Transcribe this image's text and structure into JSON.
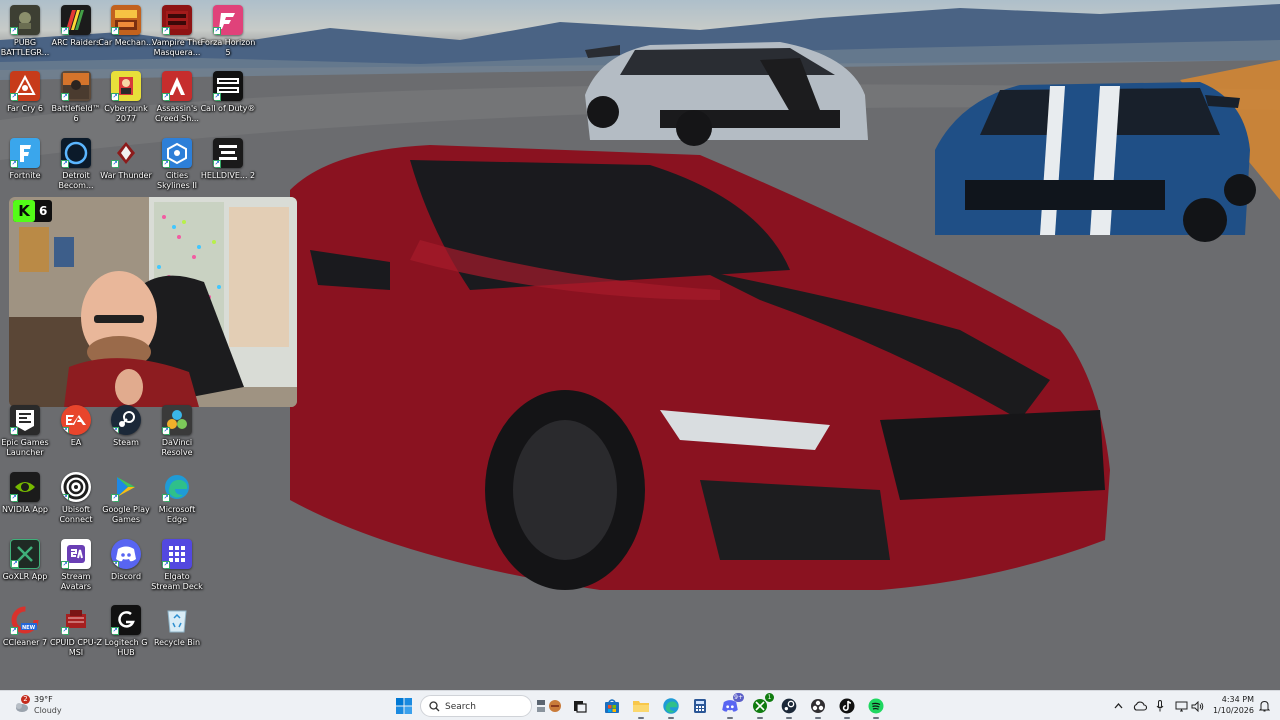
{
  "desktop": {
    "icons": [
      {
        "label": "PUBG BATTLEGR...",
        "icon": "pubg-icon",
        "color": "#3d3f33"
      },
      {
        "label": "ARC Raiders",
        "icon": "arc-raiders-icon",
        "color": "#1b1b1b"
      },
      {
        "label": "Car Mechan...",
        "icon": "car-mechanic-icon",
        "color": "#c2621e"
      },
      {
        "label": "Vampire The Masquera...",
        "icon": "vampire-icon",
        "color": "#8e1414"
      },
      {
        "label": "Forza Horizon 5",
        "icon": "forza-icon",
        "color": "#e0427a"
      },
      {
        "label": "Far Cry 6",
        "icon": "far-cry-icon",
        "color": "#c73b1a"
      },
      {
        "label": "Battlefield™ 6",
        "icon": "battlefield-icon",
        "color": "#5d4a3a"
      },
      {
        "label": "Cyberpunk 2077",
        "icon": "cyberpunk-icon",
        "color": "#e8df3a"
      },
      {
        "label": "Assassin's Creed Sh...",
        "icon": "assassins-creed-icon",
        "color": "#c62d2d"
      },
      {
        "label": "Call of Duty®",
        "icon": "call-of-duty-icon",
        "color": "#111111"
      },
      {
        "label": "Fortnite",
        "icon": "fortnite-icon",
        "color": "#3aa6ec"
      },
      {
        "label": "Detroit Becom...",
        "icon": "detroit-icon",
        "color": "#1e4f86"
      },
      {
        "label": "War Thunder",
        "icon": "war-thunder-icon",
        "color": "#8c1b1b"
      },
      {
        "label": "Cities Skylines II",
        "icon": "cities-skylines-icon",
        "color": "#2d7fd8"
      },
      {
        "label": "HELLDIVE... 2",
        "icon": "helldivers-icon",
        "color": "#1a1a1a"
      },
      {
        "label": "Epic Games Launcher",
        "icon": "epic-games-icon",
        "color": "#2a2a2a"
      },
      {
        "label": "EA",
        "icon": "ea-icon",
        "color": "#e8452c"
      },
      {
        "label": "Steam",
        "icon": "steam-icon",
        "color": "#1b2838"
      },
      {
        "label": "DaVinci Resolve",
        "icon": "davinci-resolve-icon",
        "color": "#3a3a3a"
      },
      {
        "label": "NVIDIA App",
        "icon": "nvidia-icon",
        "color": "#76b900"
      },
      {
        "label": "Ubisoft Connect",
        "icon": "ubisoft-icon",
        "color": "#1d1d1d"
      },
      {
        "label": "Google Play Games",
        "icon": "google-play-games-icon",
        "color": "#2fa44f"
      },
      {
        "label": "Microsoft Edge",
        "icon": "edge-icon",
        "color": "#1f9bd6"
      },
      {
        "label": "GoXLR App",
        "icon": "goxlr-icon",
        "color": "#2f6e4d"
      },
      {
        "label": "Stream Avatars",
        "icon": "stream-avatars-icon",
        "color": "#ffffff"
      },
      {
        "label": "Discord",
        "icon": "discord-icon",
        "color": "#5865f2"
      },
      {
        "label": "Elgato Stream Deck",
        "icon": "stream-deck-icon",
        "color": "#5348e0"
      },
      {
        "label": "CCleaner 7",
        "icon": "ccleaner-icon",
        "color": "#d8322c"
      },
      {
        "label": "CPUID CPU-Z MSI",
        "icon": "cpuz-icon",
        "color": "#a61f1f"
      },
      {
        "label": "Logitech G HUB",
        "icon": "logitech-ghub-icon",
        "color": "#111111"
      },
      {
        "label": "Recycle Bin",
        "icon": "recycle-bin-icon",
        "color": "#d9ecf6"
      }
    ]
  },
  "overlay": {
    "kick_badge_letter": "K",
    "kick_viewer_count": "6",
    "kick_color": "#53fc18"
  },
  "taskbar": {
    "weather": {
      "temp": "39°F",
      "condition": "Cloudy",
      "badge": "2"
    },
    "search_placeholder": "Search",
    "apps": [
      {
        "name": "start-button-icon",
        "active": false
      },
      {
        "name": "widgets-icon",
        "active": false
      },
      {
        "name": "task-view-icon",
        "active": false
      },
      {
        "name": "store-icon",
        "active": false
      },
      {
        "name": "file-explorer-icon",
        "active": true
      },
      {
        "name": "edge-icon",
        "active": true
      },
      {
        "name": "calculator-icon",
        "active": false
      },
      {
        "name": "discord-icon",
        "active": true,
        "badge": "9+"
      },
      {
        "name": "xbox-icon",
        "active": true,
        "badge": "1"
      },
      {
        "name": "steam-icon",
        "active": true
      },
      {
        "name": "obs-icon",
        "active": true
      },
      {
        "name": "tiktok-icon",
        "active": true
      },
      {
        "name": "spotify-icon",
        "active": true
      }
    ],
    "tray": [
      "chevron-up-icon",
      "cloud-icon",
      "microphone-icon",
      "network-icon",
      "volume-icon",
      "battery-icon"
    ],
    "clock": {
      "time": "4:34 PM",
      "date": "1/10/2026"
    },
    "accent": "#0067c0"
  }
}
